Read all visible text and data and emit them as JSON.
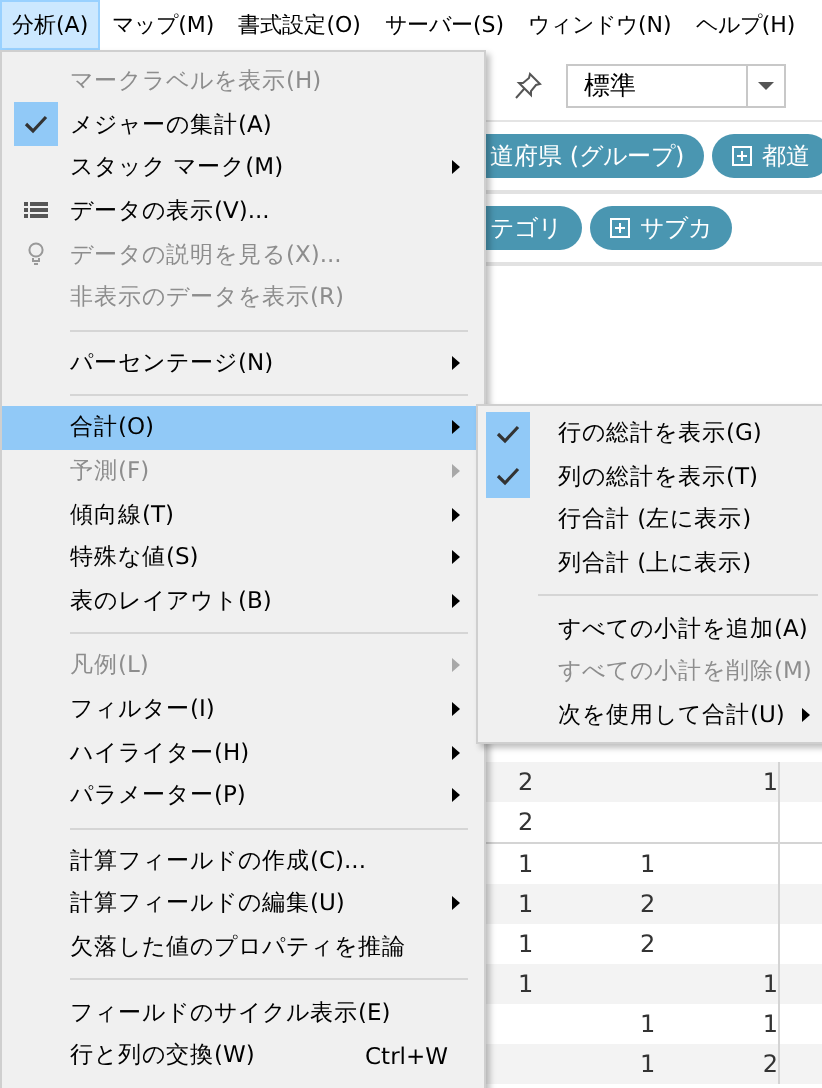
{
  "menubar": [
    {
      "label": "分析(A)",
      "selected": true
    },
    {
      "label": "マップ(M)",
      "selected": false
    },
    {
      "label": "書式設定(O)",
      "selected": false
    },
    {
      "label": "サーバー(S)",
      "selected": false
    },
    {
      "label": "ウィンドウ(N)",
      "selected": false
    },
    {
      "label": "ヘルプ(H)",
      "selected": false
    }
  ],
  "toolbar": {
    "fit_dropdown": {
      "value": "標準"
    }
  },
  "shelves": [
    {
      "pills": [
        {
          "label": "道府県 (グループ)",
          "expandable": false
        },
        {
          "label": "都道",
          "expandable": true
        }
      ]
    },
    {
      "pills": [
        {
          "label": "テゴリ",
          "expandable": false
        },
        {
          "label": "サブカ",
          "expandable": true
        }
      ]
    }
  ],
  "menu": [
    {
      "kind": "toggle",
      "label": "マークラベルを表示(H)",
      "checked": false,
      "disabled": true,
      "submenu": false,
      "selected": false
    },
    {
      "kind": "toggle",
      "label": "メジャーの集計(A)",
      "checked": true,
      "disabled": false,
      "submenu": false,
      "selected": false
    },
    {
      "kind": "command",
      "label": "スタック マーク(M)",
      "disabled": false,
      "submenu": true,
      "selected": false
    },
    {
      "kind": "grid-command",
      "label": "データの表示(V)...",
      "disabled": false,
      "submenu": false,
      "selected": false
    },
    {
      "kind": "bulb-command",
      "label": "データの説明を見る(X)...",
      "disabled": true,
      "submenu": false,
      "selected": false
    },
    {
      "kind": "command",
      "label": "非表示のデータを表示(R)",
      "disabled": true,
      "submenu": false,
      "selected": false
    },
    {
      "kind": "separator"
    },
    {
      "kind": "command",
      "label": "パーセンテージ(N)",
      "disabled": false,
      "submenu": true,
      "selected": false
    },
    {
      "kind": "separator"
    },
    {
      "kind": "command",
      "label": "合計(O)",
      "disabled": false,
      "submenu": true,
      "selected": true
    },
    {
      "kind": "command",
      "label": "予測(F)",
      "disabled": true,
      "submenu": true,
      "selected": false
    },
    {
      "kind": "command",
      "label": "傾向線(T)",
      "disabled": false,
      "submenu": true,
      "selected": false
    },
    {
      "kind": "command",
      "label": "特殊な値(S)",
      "disabled": false,
      "submenu": true,
      "selected": false
    },
    {
      "kind": "command",
      "label": "表のレイアウト(B)",
      "disabled": false,
      "submenu": true,
      "selected": false
    },
    {
      "kind": "separator"
    },
    {
      "kind": "command",
      "label": "凡例(L)",
      "disabled": true,
      "submenu": true,
      "selected": false
    },
    {
      "kind": "command",
      "label": "フィルター(I)",
      "disabled": false,
      "submenu": true,
      "selected": false
    },
    {
      "kind": "command",
      "label": "ハイライター(H)",
      "disabled": false,
      "submenu": true,
      "selected": false
    },
    {
      "kind": "command",
      "label": "パラメーター(P)",
      "disabled": false,
      "submenu": true,
      "selected": false
    },
    {
      "kind": "separator"
    },
    {
      "kind": "command",
      "label": "計算フィールドの作成(C)...",
      "disabled": false,
      "submenu": false,
      "selected": false
    },
    {
      "kind": "command",
      "label": "計算フィールドの編集(U)",
      "disabled": false,
      "submenu": true,
      "selected": false
    },
    {
      "kind": "command",
      "label": "欠落した値のプロパティを推論",
      "disabled": false,
      "submenu": false,
      "selected": false
    },
    {
      "kind": "separator"
    },
    {
      "kind": "command",
      "label": "フィールドのサイクル表示(E)",
      "disabled": false,
      "submenu": false,
      "selected": false
    },
    {
      "kind": "command",
      "label": "行と列の交換(W)",
      "shortcut": "Ctrl+W",
      "disabled": false,
      "submenu": false,
      "selected": false
    }
  ],
  "submenu": [
    {
      "kind": "toggle",
      "label": "行の総計を表示(G)",
      "checked": true,
      "disabled": false,
      "submenu": false
    },
    {
      "kind": "toggle",
      "label": "列の総計を表示(T)",
      "checked": true,
      "disabled": false,
      "submenu": false
    },
    {
      "kind": "command",
      "label": "行合計 (左に表示)",
      "disabled": false,
      "submenu": false
    },
    {
      "kind": "command",
      "label": "列合計 (上に表示)",
      "disabled": false,
      "submenu": false
    },
    {
      "kind": "separator"
    },
    {
      "kind": "command",
      "label": "すべての小計を追加(A)",
      "disabled": false,
      "submenu": false
    },
    {
      "kind": "command",
      "label": "すべての小計を削除(M)",
      "disabled": true,
      "submenu": false
    },
    {
      "kind": "command",
      "label": "次を使用して合計(U)",
      "disabled": false,
      "submenu": true
    }
  ],
  "table": {
    "groups": [
      [
        {
          "column_1": "2",
          "column_3": "1"
        },
        {
          "column_1": "2"
        }
      ],
      [
        {
          "column_1": "1",
          "column_2": "1"
        },
        {
          "column_1": "1",
          "column_2": "2"
        },
        {
          "column_1": "1",
          "column_2": "2"
        },
        {
          "column_1": "1",
          "column_3": "1"
        },
        {
          "column_2": "1",
          "column_3": "1"
        },
        {
          "column_2": "1",
          "column_3": "2"
        }
      ]
    ]
  }
}
